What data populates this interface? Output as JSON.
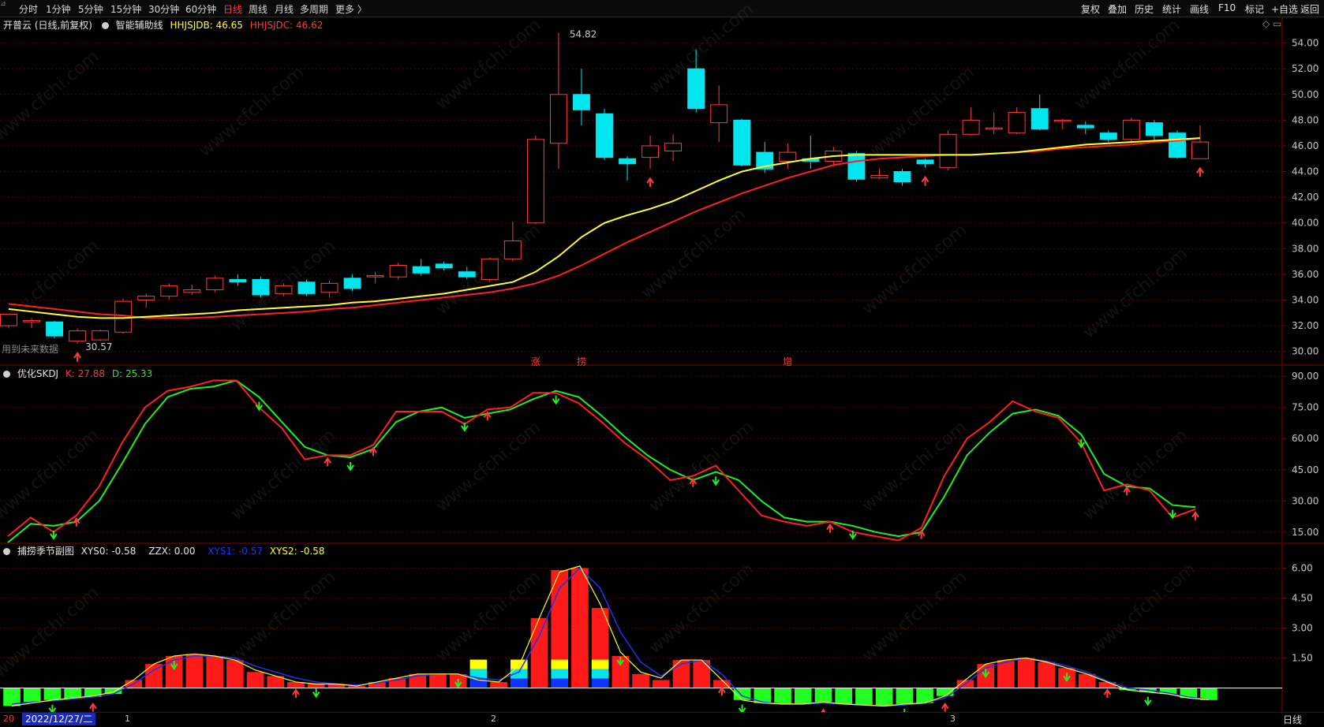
{
  "toolbar": {
    "tabs": [
      "分时",
      "1分钟",
      "5分钟",
      "15分钟",
      "30分钟",
      "60分钟",
      "日线",
      "周线",
      "月线",
      "多周期",
      "更多 〉"
    ],
    "active_tab": "日线",
    "right_buttons": [
      "复权",
      "叠加",
      "历史",
      "统计",
      "画线",
      "F10",
      "标记",
      "+自选",
      "返回"
    ]
  },
  "main_panel": {
    "title": "开普云 (日线,前复权)",
    "indicator": "智能辅助线",
    "hhjsjdb": "HHJSJDB: 46.65",
    "hhjsjdc": "HHJSJDC: 46.62",
    "high_label": "54.82",
    "low_label": "30.57",
    "future_note": "用到未来数据",
    "markers": [
      "涨",
      "捞",
      "增"
    ],
    "colors": {
      "up": "#ff3b3b",
      "down": "#00e5ee",
      "ma1": "#ffff33",
      "ma2": "#ff2020"
    }
  },
  "kdj_panel": {
    "name": "优化SKDJ",
    "k": "K: 27.88",
    "d": "D: 25.33"
  },
  "season_panel": {
    "name": "捕捞季节副图",
    "xys0": "XYS0: -0.58",
    "zzx": "ZZX: 0.00",
    "xys1": "XYS1: -0.57",
    "xys2": "XYS2: -0.58"
  },
  "status_bar": {
    "date": "2022/12/27/二",
    "left_num": "20",
    "months": [
      "1",
      "2",
      "3"
    ],
    "period": "日线"
  },
  "watermark": "www.cfchi.com",
  "chart_data": [
    {
      "type": "candlestick",
      "y_ticks": [
        "54.00",
        "52.00",
        "50.00",
        "48.00",
        "46.00",
        "44.00",
        "42.00",
        "40.00",
        "38.00",
        "36.00",
        "34.00",
        "32.00",
        "30.00"
      ],
      "ylim": [
        29,
        56
      ],
      "candles": [
        [
          32.0,
          32.9,
          32.5,
          31.8
        ],
        [
          32.4,
          32.4,
          32.6,
          31.8
        ],
        [
          32.3,
          31.2,
          32.4,
          31.0
        ],
        [
          30.8,
          31.6,
          31.8,
          30.6
        ],
        [
          30.9,
          31.6,
          31.7,
          30.8
        ],
        [
          31.5,
          33.9,
          34.1,
          31.4
        ],
        [
          34.0,
          34.3,
          34.5,
          33.4
        ],
        [
          34.3,
          35.1,
          35.3,
          34.0
        ],
        [
          34.6,
          34.8,
          35.2,
          34.4
        ],
        [
          34.8,
          35.7,
          35.9,
          34.6
        ],
        [
          35.6,
          35.4,
          36.0,
          35.1
        ],
        [
          35.6,
          34.4,
          35.8,
          34.2
        ],
        [
          34.5,
          35.1,
          35.3,
          34.3
        ],
        [
          35.4,
          34.5,
          35.6,
          34.3
        ],
        [
          34.6,
          35.3,
          35.5,
          34.2
        ],
        [
          35.7,
          34.9,
          36.0,
          34.7
        ],
        [
          35.8,
          35.9,
          36.2,
          35.3
        ],
        [
          35.8,
          36.7,
          36.9,
          35.6
        ],
        [
          36.6,
          36.1,
          37.2,
          35.9
        ],
        [
          36.8,
          36.5,
          37.0,
          36.3
        ],
        [
          36.2,
          35.8,
          36.6,
          35.6
        ],
        [
          35.6,
          37.2,
          37.3,
          35.4
        ],
        [
          37.2,
          38.6,
          40.1,
          37.0
        ],
        [
          40.0,
          46.5,
          46.8,
          39.9
        ],
        [
          46.2,
          50.0,
          54.8,
          44.2
        ],
        [
          50.0,
          48.8,
          52.0,
          47.6
        ],
        [
          48.5,
          45.1,
          48.9,
          44.9
        ],
        [
          45.0,
          44.6,
          45.2,
          43.3
        ],
        [
          45.1,
          46.0,
          46.8,
          44.2
        ],
        [
          45.6,
          46.2,
          46.9,
          44.8
        ],
        [
          52.0,
          48.9,
          53.5,
          48.6
        ],
        [
          47.8,
          49.2,
          50.7,
          46.3
        ],
        [
          48.0,
          44.5,
          48.1,
          44.4
        ],
        [
          45.5,
          44.2,
          46.3,
          43.9
        ],
        [
          44.8,
          45.5,
          46.2,
          44.2
        ],
        [
          45.0,
          44.8,
          46.8,
          44.2
        ],
        [
          44.8,
          45.6,
          45.9,
          44.4
        ],
        [
          45.4,
          43.4,
          45.6,
          43.2
        ],
        [
          43.5,
          43.7,
          44.2,
          43.4
        ],
        [
          44.0,
          43.2,
          44.2,
          42.9
        ],
        [
          44.9,
          44.6,
          45.0,
          44.3
        ],
        [
          44.3,
          46.9,
          47.2,
          44.1
        ],
        [
          46.9,
          48.0,
          49.0,
          46.8
        ],
        [
          47.3,
          47.4,
          48.6,
          46.9
        ],
        [
          47.0,
          48.6,
          49.0,
          46.9
        ],
        [
          48.9,
          47.3,
          50.0,
          47.2
        ],
        [
          48.0,
          48.0,
          48.1,
          47.3
        ],
        [
          47.6,
          47.4,
          47.9,
          46.9
        ],
        [
          47.0,
          46.5,
          47.2,
          46.3
        ],
        [
          46.5,
          48.0,
          48.2,
          46.2
        ],
        [
          47.8,
          46.8,
          48.0,
          46.4
        ],
        [
          47.0,
          45.1,
          47.2,
          45.0
        ],
        [
          45.0,
          46.3,
          47.6,
          45.0
        ]
      ],
      "ma1": [
        33.3,
        33.1,
        32.9,
        32.7,
        32.6,
        32.6,
        32.7,
        32.8,
        32.9,
        33.0,
        33.2,
        33.3,
        33.4,
        33.5,
        33.6,
        33.8,
        33.9,
        34.1,
        34.3,
        34.5,
        34.8,
        35.1,
        35.4,
        36.2,
        37.4,
        38.9,
        40.0,
        40.6,
        41.1,
        41.7,
        42.5,
        43.3,
        44.0,
        44.4,
        44.7,
        45.0,
        45.2,
        45.3,
        45.3,
        45.3,
        45.3,
        45.3,
        45.3,
        45.4,
        45.5,
        45.7,
        45.9,
        46.1,
        46.2,
        46.3,
        46.4,
        46.5,
        46.6
      ],
      "ma2": [
        33.7,
        33.5,
        33.3,
        33.1,
        32.9,
        32.8,
        32.6,
        32.6,
        32.6,
        32.7,
        32.8,
        32.9,
        33.0,
        33.1,
        33.3,
        33.4,
        33.6,
        33.8,
        34.0,
        34.2,
        34.4,
        34.6,
        34.9,
        35.3,
        35.9,
        36.7,
        37.6,
        38.5,
        39.3,
        40.1,
        40.9,
        41.6,
        42.3,
        42.9,
        43.5,
        44.0,
        44.5,
        44.8,
        45.0,
        45.1,
        45.2,
        45.3,
        45.3,
        45.4,
        45.5,
        45.6,
        45.8,
        45.9,
        46.0,
        46.1,
        46.3,
        46.4,
        46.6
      ]
    },
    {
      "type": "line",
      "title": "优化SKDJ",
      "y_ticks": [
        "90.00",
        "75.00",
        "60.00",
        "45.00",
        "30.00",
        "15.00"
      ],
      "ylim": [
        10,
        95
      ],
      "series": [
        {
          "name": "K",
          "values": [
            13,
            22,
            15,
            23,
            37,
            58,
            75,
            83,
            85,
            88,
            88,
            75,
            65,
            50,
            52,
            52,
            57,
            73,
            73,
            73,
            67,
            74,
            75,
            82,
            82,
            77,
            68,
            58,
            50,
            40,
            42,
            47,
            35,
            23,
            20,
            18,
            20,
            15,
            13,
            11,
            17,
            42,
            60,
            68,
            78,
            73,
            70,
            58,
            35,
            38,
            35,
            22,
            26
          ]
        },
        {
          "name": "D",
          "values": [
            10,
            19,
            18,
            20,
            30,
            48,
            67,
            80,
            84,
            85,
            88,
            80,
            68,
            56,
            52,
            51,
            55,
            68,
            73,
            75,
            70,
            72,
            74,
            79,
            83,
            80,
            71,
            61,
            52,
            45,
            40,
            44,
            40,
            30,
            22,
            20,
            20,
            18,
            15,
            13,
            15,
            32,
            52,
            63,
            72,
            74,
            71,
            62,
            43,
            37,
            36,
            28,
            27
          ]
        }
      ]
    },
    {
      "type": "bar",
      "title": "捕捞季节副图",
      "y_ticks": [
        "6.00",
        "4.50",
        "3.00",
        "1.50"
      ],
      "ylim": [
        -1.2,
        7.2
      ],
      "bars": [
        -0.9,
        -0.7,
        -0.6,
        -0.55,
        -0.45,
        -0.3,
        0.4,
        1.2,
        1.6,
        1.7,
        1.6,
        1.4,
        0.8,
        0.6,
        0.3,
        0.2,
        0.2,
        0.1,
        0.3,
        0.5,
        0.7,
        0.7,
        0.7,
        0.4,
        0.3,
        1.0,
        3.5,
        5.9,
        6.0,
        4.0,
        1.6,
        0.7,
        0.4,
        1.4,
        1.4,
        0.4,
        -0.6,
        -0.75,
        -0.8,
        -0.8,
        -0.7,
        -0.8,
        -0.85,
        -0.9,
        -0.8,
        -0.75,
        -0.4,
        0.4,
        1.2,
        1.4,
        1.5,
        1.3,
        1.0,
        0.7,
        0.3,
        -0.1,
        -0.2,
        -0.3,
        -0.5,
        -0.6
      ],
      "xys1": [
        -0.8,
        -0.7,
        -0.65,
        -0.55,
        -0.45,
        -0.3,
        0.2,
        0.9,
        1.4,
        1.6,
        1.6,
        1.5,
        1.1,
        0.8,
        0.5,
        0.3,
        0.2,
        0.15,
        0.25,
        0.4,
        0.6,
        0.7,
        0.7,
        0.5,
        0.4,
        0.8,
        2.6,
        5.0,
        6.0,
        5.0,
        2.8,
        1.3,
        0.6,
        1.2,
        1.4,
        0.7,
        -0.4,
        -0.7,
        -0.8,
        -0.8,
        -0.75,
        -0.8,
        -0.85,
        -0.9,
        -0.85,
        -0.75,
        -0.5,
        0.2,
        1.0,
        1.3,
        1.5,
        1.35,
        1.1,
        0.8,
        0.35,
        0.0,
        -0.1,
        -0.25,
        -0.45,
        -0.57
      ],
      "xys2": [
        -0.9,
        -0.75,
        -0.6,
        -0.5,
        -0.4,
        -0.2,
        0.4,
        1.2,
        1.6,
        1.7,
        1.6,
        1.4,
        0.9,
        0.6,
        0.3,
        0.2,
        0.2,
        0.1,
        0.3,
        0.5,
        0.7,
        0.7,
        0.7,
        0.4,
        0.3,
        1.1,
        3.5,
        5.8,
        6.1,
        4.2,
        1.8,
        0.8,
        0.5,
        1.4,
        1.4,
        0.4,
        -0.6,
        -0.75,
        -0.8,
        -0.8,
        -0.7,
        -0.8,
        -0.85,
        -0.9,
        -0.8,
        -0.75,
        -0.4,
        0.4,
        1.2,
        1.4,
        1.5,
        1.3,
        1.0,
        0.7,
        0.3,
        -0.1,
        -0.2,
        -0.3,
        -0.5,
        -0.58
      ]
    }
  ]
}
